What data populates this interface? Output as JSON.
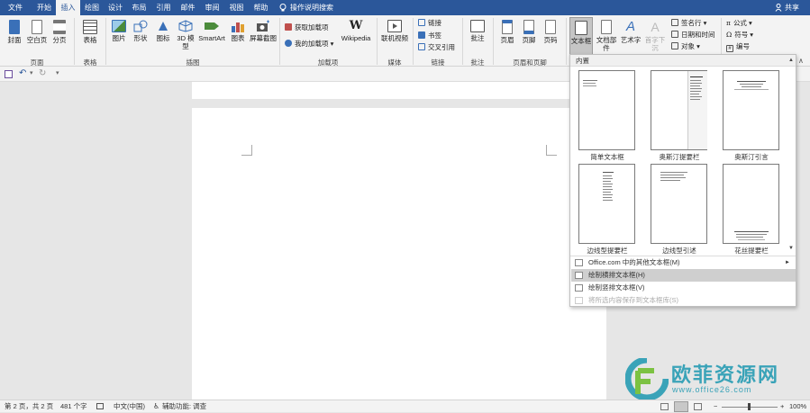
{
  "tabs": [
    "文件",
    "开始",
    "插入",
    "绘图",
    "设计",
    "布局",
    "引用",
    "邮件",
    "审阅",
    "视图",
    "帮助"
  ],
  "active_tab": "插入",
  "tell_me": "操作说明搜索",
  "share": "共享",
  "ribbon": {
    "pages": {
      "cover": "封面",
      "blank": "空白页",
      "break": "分页",
      "group": "页面"
    },
    "tables": {
      "table": "表格",
      "group": "表格"
    },
    "illustrations": {
      "pictures": "图片",
      "shapes": "形状",
      "icons": "图标",
      "models_line1": "3D 模",
      "models_line2": "型",
      "smartart": "SmartArt",
      "chart": "图表",
      "screenshot": "屏幕截图",
      "group": "插图"
    },
    "addins": {
      "get": "获取加载项",
      "mine": "我的加载项",
      "wikipedia": "Wikipedia",
      "group": "加载项"
    },
    "media": {
      "video": "联机视频",
      "group": "媒体"
    },
    "links": {
      "link": "链接",
      "bookmark": "书签",
      "crossref": "交叉引用",
      "group": "链接"
    },
    "comments": {
      "comment": "批注",
      "group": "批注"
    },
    "header_footer": {
      "header": "页眉",
      "footer": "页脚",
      "page_number": "页码",
      "group": "页眉和页脚"
    },
    "text": {
      "textbox": "文本框",
      "quickparts": "文档部件",
      "wordart": "艺术字",
      "dropcap": "首字下沉",
      "signature": "签名行",
      "datetime": "日期和时间",
      "object": "对象"
    },
    "symbols": {
      "equation": "公式",
      "symbol": "符号",
      "number": "编号"
    }
  },
  "gallery": {
    "header": "内置",
    "items": [
      "简单文本框",
      "奥斯汀提要栏",
      "奥斯汀引言",
      "边线型提要栏",
      "边线型引述",
      "花丝提要栏"
    ],
    "menu": [
      {
        "label": "Office.com 中的其他文本框(M)",
        "enabled": true
      },
      {
        "label": "绘制横排文本框(H)",
        "enabled": true
      },
      {
        "label": "绘制竖排文本框(V)",
        "enabled": true
      },
      {
        "label": "将所选内容保存到文本框库(S)",
        "enabled": false
      }
    ]
  },
  "status": {
    "page": "第 2 页，共 2 页",
    "words": "481 个字",
    "language": "中文(中国)",
    "accessibility": "辅助功能: 调查",
    "zoom": "100%"
  },
  "watermark": {
    "text": "欧菲资源网",
    "url": "www.office26.com"
  },
  "colors": {
    "accent": "#2b579a",
    "watermark_teal": "#3aa3b8",
    "watermark_green": "#7cc242"
  }
}
